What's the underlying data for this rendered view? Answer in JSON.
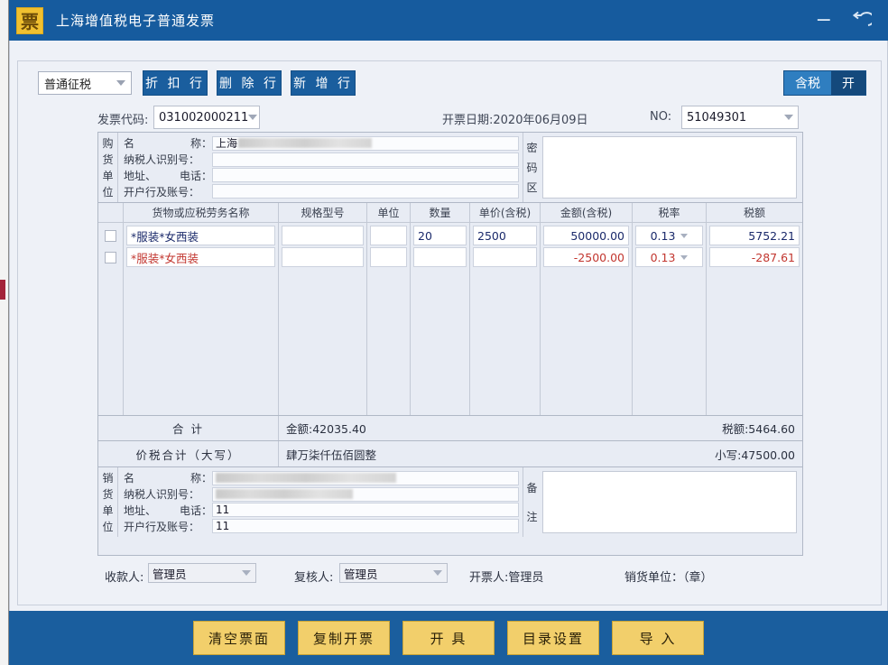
{
  "window": {
    "title": "上海增值税电子普通发票",
    "icon_label": "票",
    "minimize_label": "−",
    "restore_icon": "back-arrow"
  },
  "toolbar": {
    "tax_mode": "普通征税",
    "discount_row_label": "折 扣 行",
    "delete_row_label": "删 除 行",
    "add_row_label": "新 增 行",
    "tax_included_label": "含税",
    "open_label": "开"
  },
  "invoice_head": {
    "code_label": "发票代码:",
    "code_value": "031002000211",
    "date_text": "开票日期:2020年06月09日",
    "no_label": "NO:",
    "no_value": "51049301"
  },
  "buyer": {
    "vlabel": [
      "购",
      "货",
      "单",
      "位"
    ],
    "fields": [
      {
        "label_left": "名",
        "label_right": "称：",
        "value": "上海",
        "redacted": true
      },
      {
        "label_left": "纳税人识别号：",
        "label_right": "",
        "value": "",
        "redacted": false
      },
      {
        "label_left": "地址、",
        "label_right": "电话：",
        "value": "",
        "redacted": false
      },
      {
        "label_left": "开户行及账号：",
        "label_right": "",
        "value": "",
        "redacted": false
      }
    ],
    "secure_label": [
      "密",
      "码",
      "区"
    ],
    "secure_value": ""
  },
  "items": {
    "headers": [
      "货物或应税劳务名称",
      "规格型号",
      "单位",
      "数量",
      "单价(含税)",
      "金额(含税)",
      "税率",
      "税额"
    ],
    "rows": [
      {
        "name": "*服装*女西装",
        "spec": "",
        "unit": "",
        "qty": "20",
        "price": "2500",
        "amount": "50000.00",
        "rate": "0.13",
        "tax": "5752.21",
        "style": "blue"
      },
      {
        "name": "*服装*女西装",
        "spec": "",
        "unit": "",
        "qty": "",
        "price": "",
        "amount": "-2500.00",
        "rate": "0.13",
        "tax": "-287.61",
        "style": "red"
      }
    ]
  },
  "totals": {
    "sum_label": "合    计",
    "sum_amount": "金额:42035.40",
    "sum_tax": "税额:5464.60",
    "grand_label": "价税合计（大写）",
    "grand_words": "肆万柒仟伍佰圆整",
    "grand_digits": "小写:47500.00"
  },
  "seller": {
    "vlabel": [
      "销",
      "货",
      "单",
      "位"
    ],
    "fields": [
      {
        "label_left": "名",
        "label_right": "称：",
        "value": "",
        "redacted": true
      },
      {
        "label_left": "纳税人识别号：",
        "label_right": "",
        "value": "",
        "redacted": true
      },
      {
        "label_left": "地址、",
        "label_right": "电话：",
        "value": "11",
        "redacted": false
      },
      {
        "label_left": "开户行及账号：",
        "label_right": "",
        "value": "11",
        "redacted": false
      }
    ],
    "remark_label": [
      "备",
      "注"
    ],
    "remark_value": ""
  },
  "signatures": {
    "payee_label": "收款人:",
    "payee_value": "管理员",
    "reviewer_label": "复核人:",
    "reviewer_value": "管理员",
    "drawer_text": "开票人:管理员",
    "seller_seal_text": "销货单位：（章）"
  },
  "actions": [
    "清空票面",
    "复制开票",
    "开  具",
    "目录设置",
    "导  入"
  ],
  "colors": {
    "titlebar": "#165b9e",
    "accent_button": "#1a5e9e",
    "action_button": "#f2cf6b",
    "row_blue": "#1b2a6b",
    "row_red": "#c2362f"
  }
}
